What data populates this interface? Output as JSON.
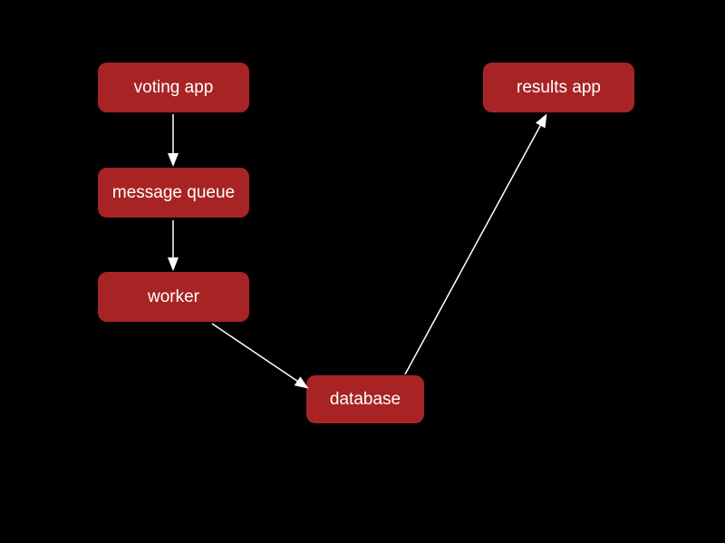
{
  "nodes": {
    "voting_app": {
      "label": "voting app"
    },
    "message_queue": {
      "label": "message queue"
    },
    "worker": {
      "label": "worker"
    },
    "database": {
      "label": "database"
    },
    "results_app": {
      "label": "results app"
    }
  },
  "edges": [
    {
      "from": "voting_app",
      "to": "message_queue"
    },
    {
      "from": "message_queue",
      "to": "worker"
    },
    {
      "from": "worker",
      "to": "database"
    },
    {
      "from": "database",
      "to": "results_app"
    }
  ]
}
